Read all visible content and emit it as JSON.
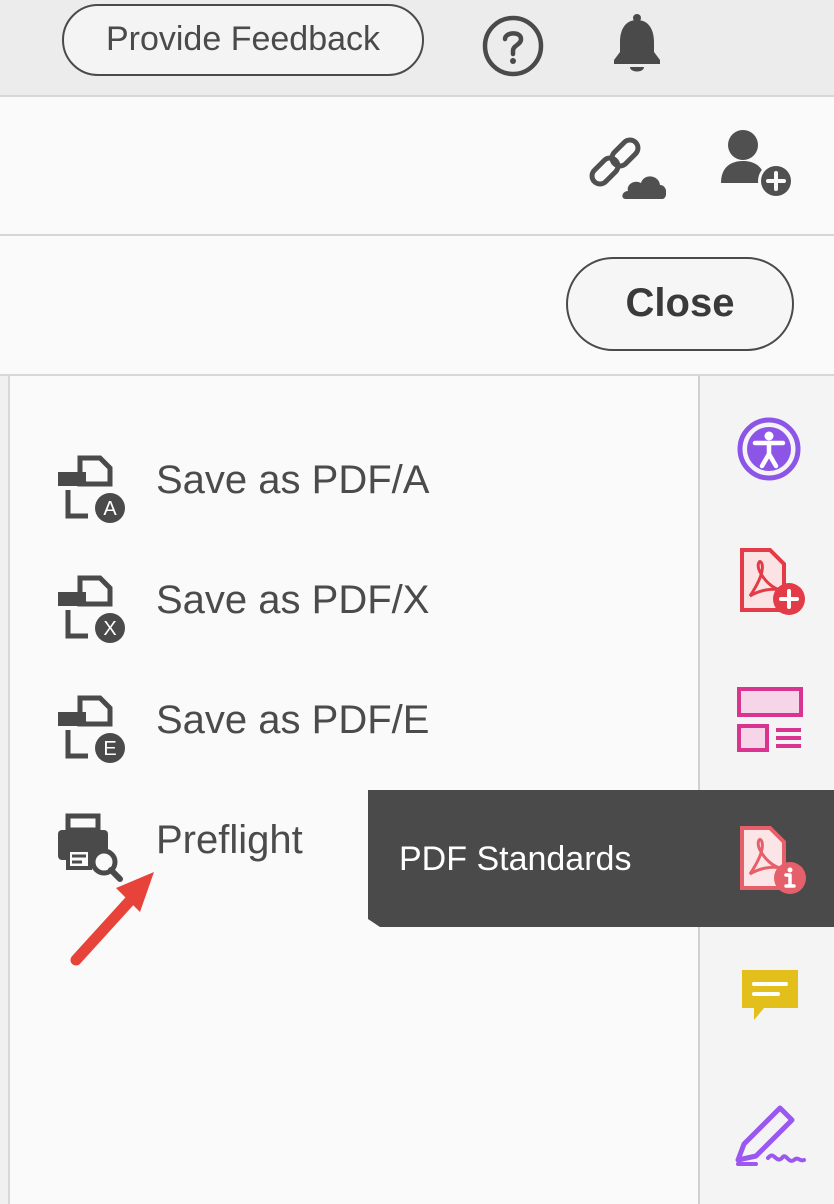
{
  "header": {
    "feedback_label": "Provide Feedback",
    "help_icon": "help-circle-icon",
    "notifications_icon": "bell-icon"
  },
  "share_toolbar": {
    "icons": [
      "link-cloud-icon",
      "add-user-icon"
    ]
  },
  "close_bar": {
    "close_label": "Close"
  },
  "panel": {
    "items": [
      {
        "label": "Save as PDF/A",
        "icon": "save-pdf-a-icon"
      },
      {
        "label": "Save as PDF/X",
        "icon": "save-pdf-x-icon"
      },
      {
        "label": "Save as PDF/E",
        "icon": "save-pdf-e-icon"
      },
      {
        "label": "Preflight",
        "icon": "preflight-icon"
      }
    ]
  },
  "right_rail": {
    "icons": [
      "accessibility-icon",
      "create-pdf-icon",
      "organize-pages-icon",
      "pdf-standards-icon",
      "comment-icon",
      "fill-sign-icon"
    ],
    "colors": {
      "accessibility": "#8d54e8",
      "create_pdf": "#e33b47",
      "organize": "#d9348f",
      "standards": "#e5606a",
      "comment": "#e2bf1b",
      "sign": "#9a58f0"
    }
  },
  "tooltip": {
    "label": "PDF Standards"
  },
  "annotation": {
    "arrow_color": "#e8433a"
  }
}
